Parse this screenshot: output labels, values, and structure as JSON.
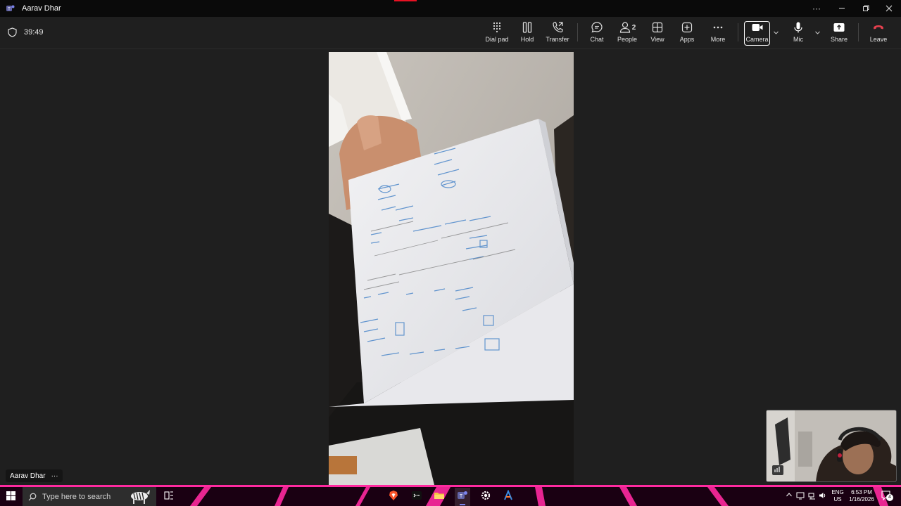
{
  "window": {
    "title": "Aarav Dhar",
    "controls": [
      "more-options",
      "minimize",
      "restore",
      "close"
    ]
  },
  "call": {
    "elapsed": "39:49"
  },
  "toolbar": {
    "dialpad_label": "Dial pad",
    "hold_label": "Hold",
    "transfer_label": "Transfer",
    "chat_label": "Chat",
    "people_label": "People",
    "people_count": "2",
    "view_label": "View",
    "apps_label": "Apps",
    "more_label": "More",
    "camera_label": "Camera",
    "mic_label": "Mic",
    "share_label": "Share",
    "leave_label": "Leave"
  },
  "colors": {
    "leave": "#e8414f",
    "accent": "#e81123",
    "taskbar_glow": "#ff2aa0",
    "worksheet_ink": "#4a86c9"
  },
  "participant": {
    "name": "Aarav Dhar"
  },
  "taskbar": {
    "search_placeholder": "Type here to search",
    "language_line1": "ENG",
    "language_line2": "US",
    "time": "6:53 PM",
    "date": "1/16/2026",
    "notification_count": "4",
    "pinned_icons": [
      "brave-icon",
      "terminal-icon",
      "file-explorer-icon",
      "teams-icon",
      "settings-icon",
      "app-icon"
    ]
  }
}
